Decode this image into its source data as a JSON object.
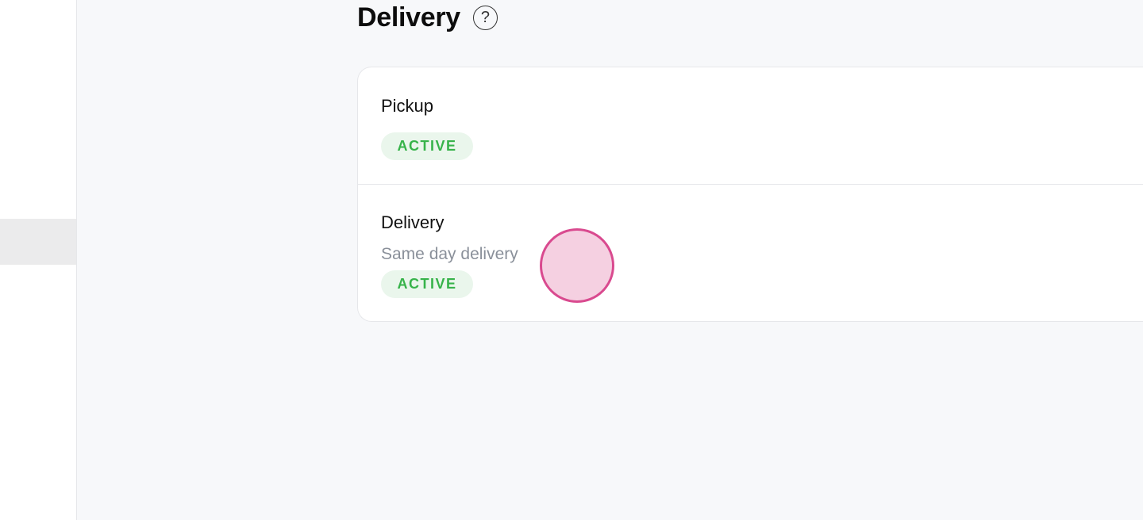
{
  "page": {
    "title": "Delivery",
    "help_icon": "?"
  },
  "options": [
    {
      "title": "Pickup",
      "description": "",
      "status": "ACTIVE"
    },
    {
      "title": "Delivery",
      "description": "Same day delivery",
      "status": "ACTIVE"
    }
  ],
  "colors": {
    "badge_bg": "#eaf6ec",
    "badge_text": "#37b34a",
    "cursor": "#d94a8f"
  }
}
